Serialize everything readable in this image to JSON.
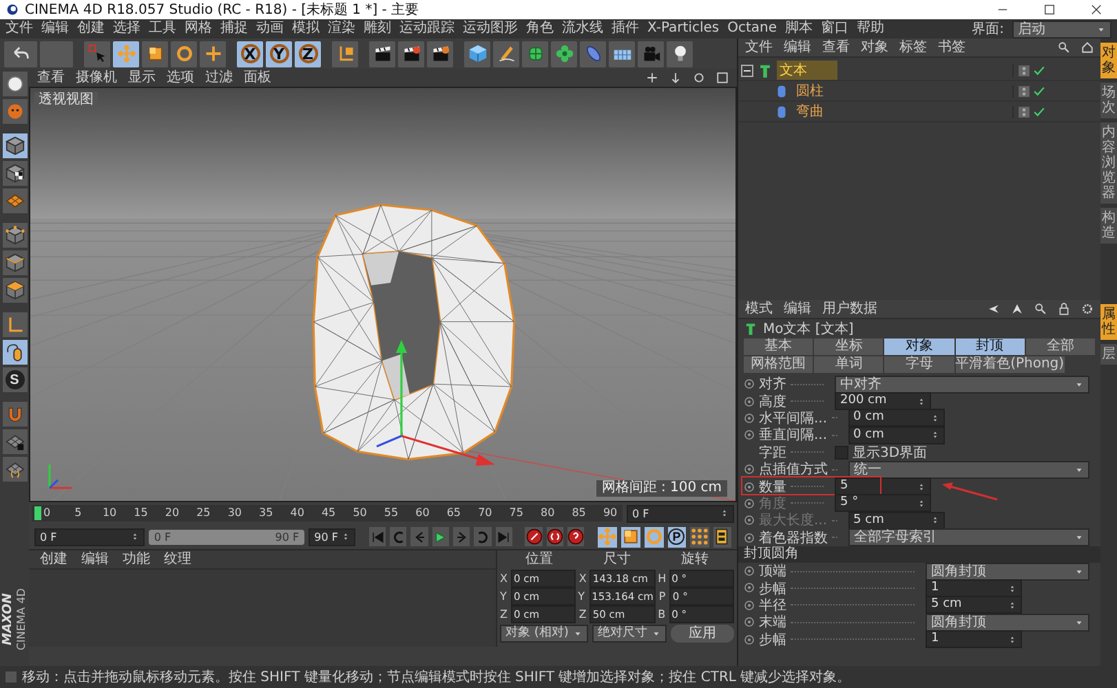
{
  "window": {
    "title": "CINEMA 4D R18.057 Studio (RC - R18) - [未标题 1 *] - 主要"
  },
  "menu_bar": {
    "items": [
      "文件",
      "编辑",
      "创建",
      "选择",
      "工具",
      "网格",
      "捕捉",
      "动画",
      "模拟",
      "渲染",
      "雕刻",
      "运动跟踪",
      "运动图形",
      "角色",
      "流水线",
      "插件",
      "X-Particles",
      "Octane",
      "脚本",
      "窗口",
      "帮助"
    ],
    "layout_label": "界面:",
    "layout_value": "启动"
  },
  "toolbar": [
    {
      "kind": "icon",
      "selected": false
    },
    {
      "kind": "icon",
      "selected": false
    },
    {
      "kind": "icon",
      "selected": false
    },
    {
      "kind": "icon",
      "selected": true
    },
    {
      "kind": "icon",
      "selected": false
    },
    {
      "kind": "icon",
      "selected": false
    },
    {
      "kind": "icon",
      "selected": false
    },
    {
      "kind": "axis",
      "label": "X",
      "selected": true
    },
    {
      "kind": "axis",
      "label": "Y",
      "selected": true
    },
    {
      "kind": "axis",
      "label": "Z",
      "selected": true
    },
    {
      "kind": "icon",
      "selected": false
    },
    {
      "kind": "icon",
      "selected": false
    },
    {
      "kind": "icon",
      "selected": false
    },
    {
      "kind": "icon",
      "selected": false
    },
    {
      "kind": "icon",
      "selected": false
    },
    {
      "kind": "icon",
      "selected": false
    },
    {
      "kind": "icon",
      "selected": false
    },
    {
      "kind": "icon",
      "selected": false
    },
    {
      "kind": "icon",
      "selected": false
    },
    {
      "kind": "icon",
      "selected": false
    },
    {
      "kind": "icon",
      "selected": false
    },
    {
      "kind": "icon",
      "selected": false
    }
  ],
  "left_toolbar": [
    {
      "kind": "icon",
      "selected": false
    },
    {
      "kind": "icon",
      "selected": false
    },
    {
      "kind": "icon",
      "selected": true
    },
    {
      "kind": "icon",
      "selected": false
    },
    {
      "kind": "icon",
      "selected": false
    },
    {
      "kind": "icon",
      "selected": false
    },
    {
      "kind": "icon",
      "selected": false
    },
    {
      "kind": "icon",
      "selected": false
    },
    {
      "kind": "icon",
      "selected": false
    },
    {
      "kind": "icon",
      "selected": true
    },
    {
      "kind": "letter",
      "label": "S",
      "selected": false
    },
    {
      "kind": "icon",
      "selected": false
    },
    {
      "kind": "icon",
      "selected": false
    },
    {
      "kind": "icon",
      "selected": false
    }
  ],
  "viewport": {
    "menu": [
      "查看",
      "摄像机",
      "显示",
      "选项",
      "过滤",
      "面板"
    ],
    "view_name": "透视视图",
    "grid_spacing": "网格间距 : 100 cm"
  },
  "timeline": {
    "ticks": [
      "0",
      "5",
      "10",
      "15",
      "20",
      "25",
      "30",
      "35",
      "40",
      "45",
      "50",
      "55",
      "60",
      "65",
      "70",
      "75",
      "80",
      "85",
      "90"
    ],
    "current_frame": "0 F"
  },
  "transport": {
    "start": "0 F",
    "range_slider": {
      "start": "0 F",
      "end": "90 F",
      "level": 1
    },
    "end": "90 F",
    "key_tracks": [
      {
        "kind": "icon",
        "selected": true
      },
      {
        "kind": "icon",
        "selected": true
      },
      {
        "kind": "icon",
        "selected": true
      },
      {
        "kind": "letter",
        "label": "P",
        "selected": true
      },
      {
        "kind": "icon",
        "selected": false
      }
    ]
  },
  "material_manager": {
    "menu": [
      "创建",
      "编辑",
      "功能",
      "纹理"
    ]
  },
  "logo": {
    "line_1": "MAXON",
    "line_2": "CINEMA 4D"
  },
  "coordinates": {
    "headers": [
      "位置",
      "尺寸",
      "旋转"
    ],
    "rows": [
      {
        "axis": "X",
        "position": "0 cm",
        "size_axis": "X",
        "size": "143.18 cm",
        "rotation_axis": "H",
        "rotation": "0 °"
      },
      {
        "axis": "Y",
        "position": "0 cm",
        "size_axis": "Y",
        "size": "153.164 cm",
        "rotation_axis": "P",
        "rotation": "0 °"
      },
      {
        "axis": "Z",
        "position": "0 cm",
        "size_axis": "Z",
        "size": "50 cm",
        "rotation_axis": "B",
        "rotation": "0 °"
      }
    ],
    "mode": "对象 (相对)",
    "size_mode": "绝对尺寸",
    "apply": "应用"
  },
  "status_bar": "移动：点击并拖动鼠标移动元素。按住 SHIFT 键量化移动；节点编辑模式时按住 SHIFT 键增加选择对象；按住 CTRL 键减少选择对象。",
  "object_manager": {
    "menu": [
      "文件",
      "编辑",
      "查看",
      "对象",
      "标签",
      "书签"
    ],
    "tree": [
      {
        "label": "文本",
        "selected": true,
        "expanded": true,
        "children": [
          {
            "label": "圆柱",
            "selected": false
          },
          {
            "label": "弯曲",
            "selected": false
          }
        ]
      }
    ]
  },
  "side_tabs": [
    {
      "label": "对象",
      "selected": true
    },
    {
      "label": "场次",
      "selected": false
    },
    {
      "label": "内容浏览器",
      "selected": false
    },
    {
      "label": "构造",
      "selected": false
    }
  ],
  "attributes": {
    "menu": [
      "模式",
      "编辑",
      "用户数据"
    ],
    "title": "Mo文本 [文本]",
    "tabs": [
      [
        {
          "label": "基本",
          "selected": false
        },
        {
          "label": "坐标",
          "selected": false
        },
        {
          "label": "对象",
          "selected": true
        },
        {
          "label": "封顶",
          "selected": true
        },
        {
          "label": "全部",
          "selected": false
        }
      ],
      [
        {
          "label": "网格范围",
          "selected": false
        },
        {
          "label": "单词",
          "selected": false
        },
        {
          "label": "字母",
          "selected": false
        },
        {
          "label": "平滑着色(Phong)",
          "selected": false
        }
      ]
    ],
    "properties": [
      {
        "kind": "dropdown",
        "label": "对齐",
        "value": "中对齐",
        "disabled": false,
        "highlighted": false
      },
      {
        "kind": "number",
        "label": "高度",
        "value": "200 cm",
        "disabled": false,
        "highlighted": false
      },
      {
        "kind": "number",
        "label": "水平间隔...",
        "value": "0 cm",
        "disabled": false,
        "highlighted": false
      },
      {
        "kind": "number",
        "label": "垂直间隔...",
        "value": "0 cm",
        "disabled": false,
        "highlighted": false
      },
      {
        "kind": "checkbox",
        "label": "字距",
        "value": "显示3D界面",
        "checked": false,
        "disabled": false,
        "highlighted": false
      },
      {
        "kind": "dropdown",
        "label": "点插值方式",
        "value": "统一",
        "disabled": false,
        "highlighted": false
      },
      {
        "kind": "number",
        "label": "数量",
        "value": "5",
        "disabled": false,
        "highlighted": true
      },
      {
        "kind": "number",
        "label": "角度",
        "value": "5 °",
        "disabled": true,
        "highlighted": false
      },
      {
        "kind": "number",
        "label": "最大长度...",
        "value": "5 cm",
        "disabled": true,
        "highlighted": false
      },
      {
        "kind": "dropdown",
        "label": "着色器指数",
        "value": "全部字母索引",
        "disabled": false,
        "highlighted": false
      },
      {
        "kind": "section",
        "label": "封顶圆角"
      },
      {
        "kind": "dropdown",
        "label": "顶端",
        "value": "圆角封顶",
        "disabled": false,
        "highlighted": false
      },
      {
        "kind": "number",
        "label": "步幅",
        "value": "1",
        "disabled": false,
        "highlighted": false
      },
      {
        "kind": "number",
        "label": "半径",
        "value": "5 cm",
        "disabled": false,
        "highlighted": false
      },
      {
        "kind": "dropdown",
        "label": "末端",
        "value": "圆角封顶",
        "disabled": false,
        "highlighted": false
      },
      {
        "kind": "number",
        "label": "步幅",
        "value": "1",
        "disabled": false,
        "highlighted": false
      }
    ]
  },
  "attribute_side_tabs": [
    {
      "label": "属性",
      "selected": true
    },
    {
      "label": "层",
      "selected": false
    }
  ]
}
